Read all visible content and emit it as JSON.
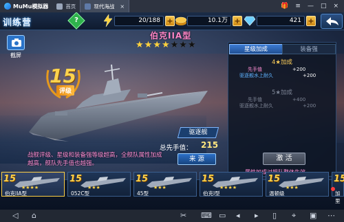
{
  "emulator": {
    "logo": "MuMu模拟器",
    "tabs": [
      {
        "label": "首页",
        "active": false
      },
      {
        "label": "现代海战",
        "active": true
      }
    ],
    "controls": [
      "gift-icon",
      "menu-icon",
      "minimize-icon",
      "maximize-icon",
      "close-icon"
    ]
  },
  "topbar": {
    "title": "训练营",
    "help": "?",
    "resources": [
      {
        "name": "energy",
        "icon": "lightning-icon",
        "value": "20/188"
      },
      {
        "name": "gold",
        "icon": "coin-icon",
        "value": "10.1万"
      },
      {
        "name": "diamond",
        "icon": "diamond-icon",
        "value": "421"
      }
    ],
    "plus": "+"
  },
  "share": {
    "label": "截屏"
  },
  "ship": {
    "name": "伯克IIA型",
    "stars_total": 7,
    "stars_filled": 4,
    "rating_level": "15",
    "rating_label": "评级",
    "type": "驱逐舰",
    "fleet_label": "总先手值：",
    "fleet_value": "215",
    "info": "战舰评级、星级和装备强等级超高，全舰队属性加成越高，舰队先手值也越强。",
    "source_button": "来 源"
  },
  "panel": {
    "tabs": [
      "星级加成",
      "装备强"
    ],
    "star4": {
      "title": "4★加成",
      "bonuses": [
        {
          "label": "先手值",
          "value": "+200"
        },
        {
          "label": "驱逐舰水上耐久",
          "value": "+200"
        }
      ]
    },
    "star5": {
      "title": "5★加成",
      "bonuses": [
        {
          "label": "先手值",
          "value": "+400"
        },
        {
          "label": "驱逐舰水上耐久",
          "value": "+200"
        }
      ]
    },
    "activate": "激 活",
    "note": "属性加成对舰队整体生效"
  },
  "carousel": [
    {
      "level": "15",
      "stars": "★★★★",
      "name": "伯克IIA型",
      "selected": true
    },
    {
      "level": "15",
      "stars": "★★★",
      "name": "052C型",
      "selected": false
    },
    {
      "level": "15",
      "stars": "★★★",
      "name": "45型",
      "selected": false
    },
    {
      "level": "15",
      "stars": "★★★★",
      "name": "伯克I型",
      "selected": false
    },
    {
      "level": "15",
      "stars": "★★★",
      "name": "温顿级",
      "selected": false
    },
    {
      "level": "15",
      "stars": "★★",
      "name": "加里",
      "selected": false
    }
  ],
  "android_nav": [
    "back-icon",
    "home-icon",
    "scissors-icon",
    "keyboard-icon",
    "screen-icon",
    "volume-down-icon",
    "volume-up-icon",
    "shake-icon",
    "location-icon",
    "apk-icon",
    "more-icon"
  ]
}
